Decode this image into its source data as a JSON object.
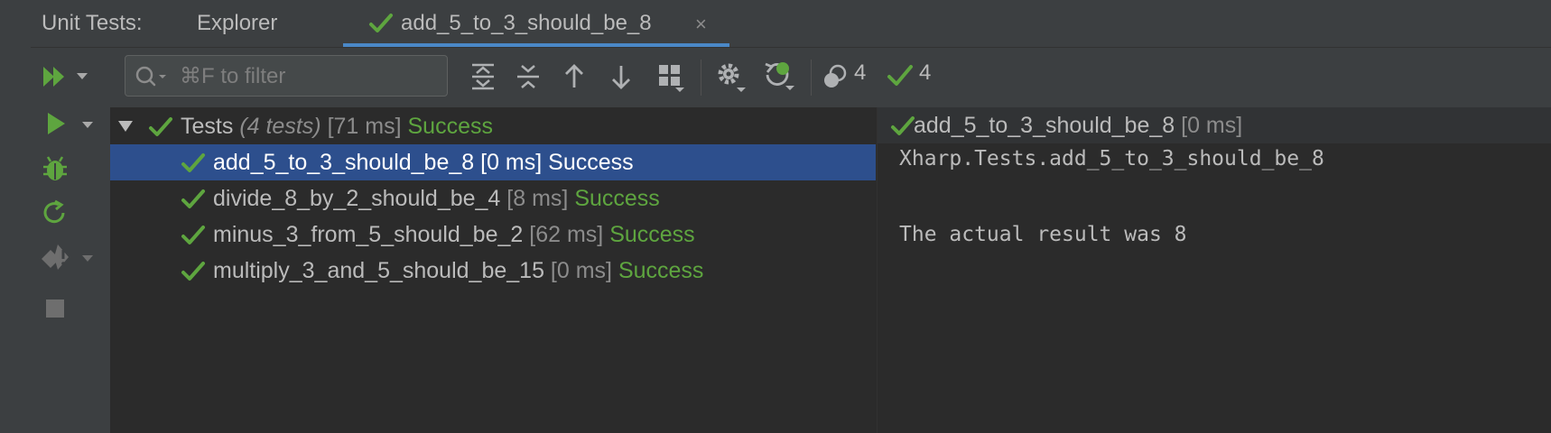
{
  "header": {
    "panel_title": "Unit Tests:",
    "explorer_tab": "Explorer",
    "active_tab": "add_5_to_3_should_be_8",
    "close_glyph": "×"
  },
  "toolbar": {
    "filter_placeholder": "⌘F to filter",
    "filter_value": "",
    "total_count": "4",
    "passed_count": "4"
  },
  "icons": {
    "run_all": "run-all-icon",
    "run": "run-icon",
    "debug": "debug-icon",
    "rerun": "rerun-icon",
    "coverage": "coverage-icon",
    "stop": "stop-icon",
    "dropdown": "chevron-down-icon"
  },
  "colors": {
    "success": "#5ea53f",
    "selection": "#2d4f8d",
    "accent": "#4a88c7"
  },
  "tree": {
    "root": {
      "name": "Tests",
      "count_label": "(4 tests)",
      "time": "[71 ms]",
      "status": "Success"
    },
    "tests": [
      {
        "name": "add_5_to_3_should_be_8",
        "time": "[0 ms]",
        "status": "Success",
        "selected": true
      },
      {
        "name": "divide_8_by_2_should_be_4",
        "time": "[8 ms]",
        "status": "Success",
        "selected": false
      },
      {
        "name": "minus_3_from_5_should_be_2",
        "time": "[62 ms]",
        "status": "Success",
        "selected": false
      },
      {
        "name": "multiply_3_and_5_should_be_15",
        "time": "[0 ms]",
        "status": "Success",
        "selected": false
      }
    ]
  },
  "output": {
    "header_name": "add_5_to_3_should_be_8",
    "header_time": "[0 ms]",
    "lines": [
      "Xharp.Tests.add_5_to_3_should_be_8",
      "",
      "The actual result was 8"
    ]
  }
}
